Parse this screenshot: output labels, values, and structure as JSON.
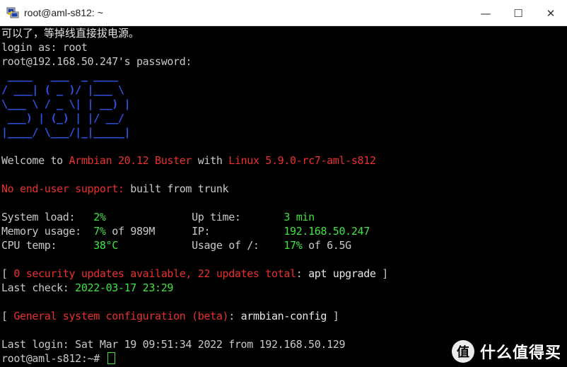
{
  "window": {
    "title": "root@aml-s812: ~",
    "minimize_glyph": "—",
    "maximize_glyph": "☐",
    "close_glyph": "✕"
  },
  "terminal": {
    "line_cn": "可以了，等掉线直接拔电源。",
    "login_as": "login as: root",
    "password_prompt": "root@192.168.50.247's password:",
    "logo": [
      " ____   ___  _ ____  ",
      "/ ___| ( _ )/ |___ \\ ",
      "\\___ \\ / _ \\| | __) |",
      " ___) | (_) | |/ __/ ",
      "|____/ \\___/|_|_____|"
    ],
    "welcome": {
      "w1": "Welcome to ",
      "os": "Armbian 20.12 Buster",
      "w2": " with ",
      "kernel": "Linux 5.9.0-rc7-aml-s812"
    },
    "support": {
      "red": "No end-user support:",
      "rest": " built from trunk"
    },
    "stats": {
      "system_load_label": "System load:   ",
      "system_load_value": "2%",
      "up_time_label": "Up time:       ",
      "up_time_value": "3 min",
      "memory_label": "Memory usage:  ",
      "memory_value": "7%",
      "memory_of": " of 989M",
      "ip_label": "IP:            ",
      "ip_value": "192.168.50.247",
      "cpu_label": "CPU temp:      ",
      "cpu_value": "38°C",
      "usage_label": "Usage of /:    ",
      "usage_value": "17%",
      "usage_of": " of 6.5G"
    },
    "updates": {
      "open": "[ ",
      "red": "0 security updates available, 22 updates total",
      "colon": ": ",
      "cmd": "apt upgrade",
      "close": " ]"
    },
    "last_check": {
      "label": "Last check: ",
      "value": "2022-03-17 23:29"
    },
    "config": {
      "open": "[ ",
      "red": "General system configuration (beta)",
      "colon": ": ",
      "cmd": "armbian-config",
      "close": " ]"
    },
    "last_login": "Last login: Sat Mar 19 09:51:34 2022 from 192.168.50.129",
    "prompt": "root@aml-s812:~# "
  },
  "watermark": {
    "logo_char": "值",
    "text": "什么值得买"
  }
}
